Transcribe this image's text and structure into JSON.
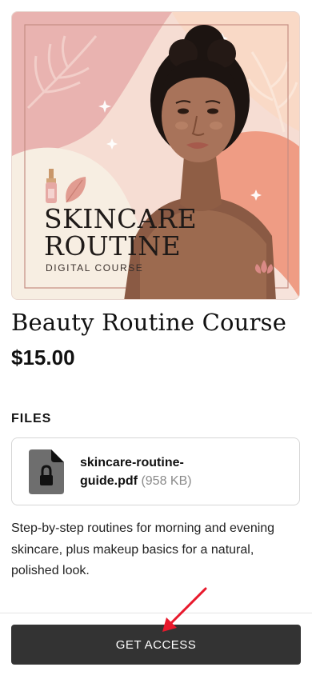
{
  "cover": {
    "title_line1": "SKINCARE",
    "title_line2": "ROUTINE",
    "subtitle": "DIGITAL COURSE"
  },
  "product": {
    "title": "Beauty Routine Course",
    "price": "$15.00"
  },
  "files": {
    "heading": "FILES",
    "items": [
      {
        "name_line1": "skincare-routine-",
        "name_line2": "guide.pdf",
        "size": "(958 KB)",
        "icon": "locked-file-icon"
      }
    ]
  },
  "description": "Step-by-step routines for morning and evening skincare, plus makeup basics for a natural, polished look.",
  "cta": {
    "label": "GET ACCESS"
  },
  "colors": {
    "button_bg": "#333333",
    "annotation_arrow": "#e8192c",
    "cover_pink": "#e9b3b0",
    "cover_peach": "#f4c7b0",
    "cover_cream": "#f7eee2"
  }
}
